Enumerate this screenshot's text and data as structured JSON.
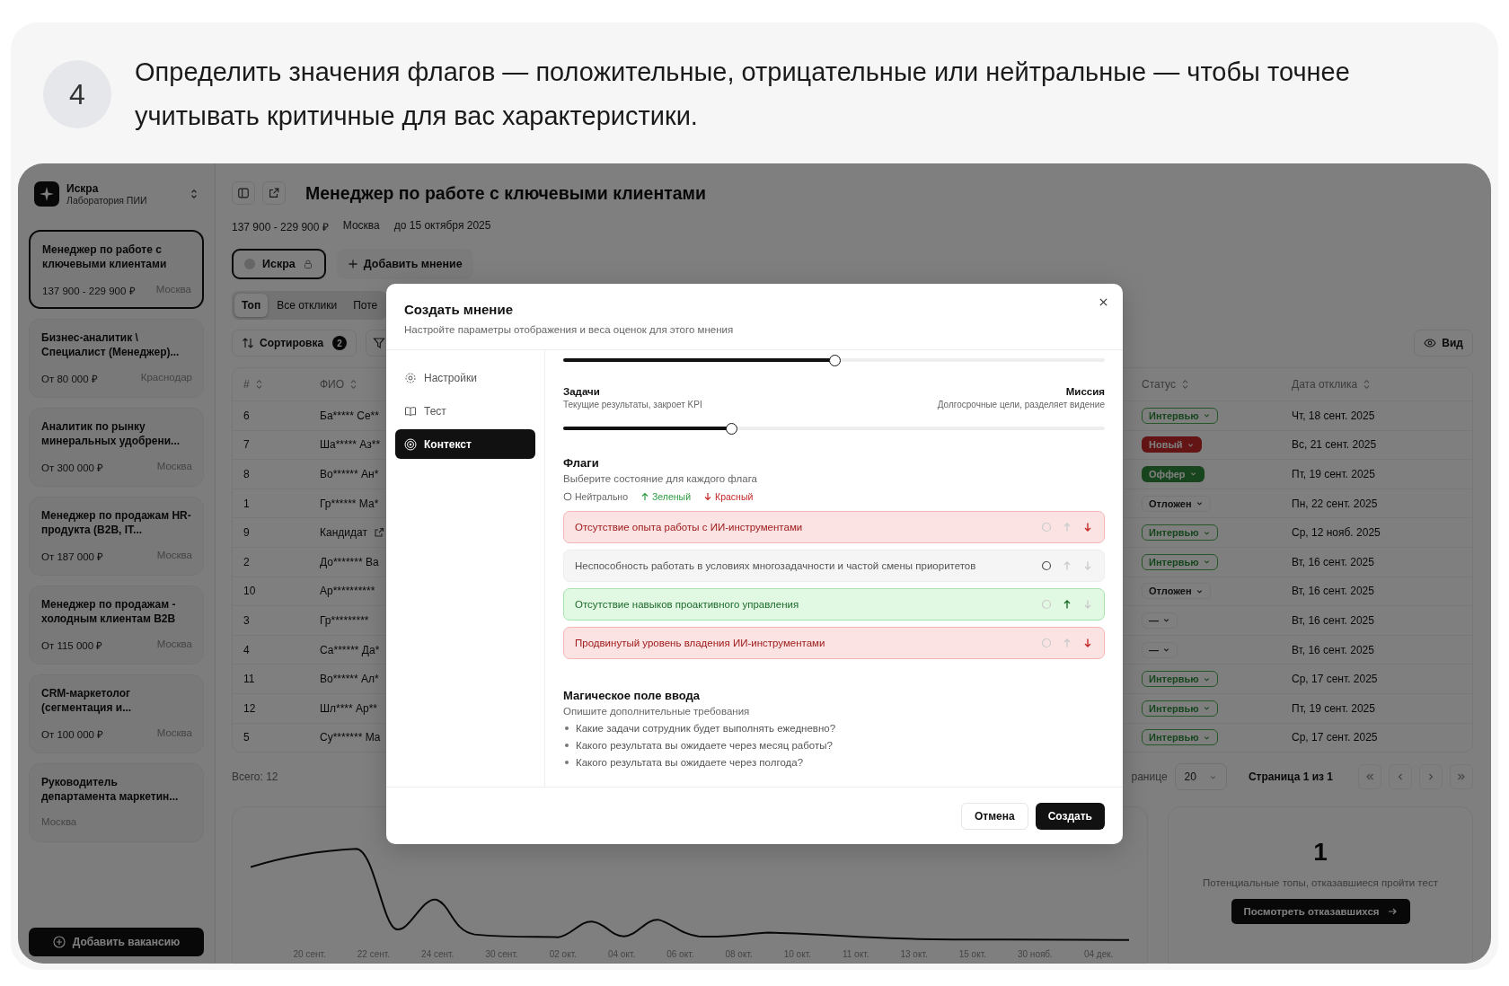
{
  "step": {
    "number": "4",
    "text": "Определить значения флагов — положительные, отрицательные или нейтральные — чтобы точнее учитывать критичные для вас характеристики."
  },
  "org": {
    "name": "Искра",
    "subtitle": "Лаборатория ПИИ"
  },
  "vacancies": [
    {
      "title": "Менеджер по работе с ключевыми клиентами",
      "salary": "137 900 - 229 900 ₽",
      "city": "Москва",
      "selected": true
    },
    {
      "title": "Бизнес-аналитик \\ Специалист (Менеджер)...",
      "salary": "От 80 000 ₽",
      "city": "Краснодар",
      "selected": false
    },
    {
      "title": "Аналитик по рынку минеральных удобрени...",
      "salary": "От 300 000 ₽",
      "city": "Москва",
      "selected": false
    },
    {
      "title": "Менеджер по продажам HR-продукта (B2B, IT...",
      "salary": "От 187 000 ₽",
      "city": "Москва",
      "selected": false
    },
    {
      "title": "Менеджер по продажам - холодным клиентам B2B",
      "salary": "От 115 000 ₽",
      "city": "Москва",
      "selected": false
    },
    {
      "title": "CRM-маркетолог (сегментация и...",
      "salary": "От 100 000 ₽",
      "city": "Москва",
      "selected": false
    },
    {
      "title": "Руководитель департамента маркетин...",
      "city": "Москва",
      "selected": false
    }
  ],
  "add_vacancy": "Добавить вакансию",
  "header": {
    "title": "Менеджер по работе с ключевыми клиентами",
    "salary": "137 900 - 229 900 ₽",
    "city": "Москва",
    "deadline": "до 15 октября 2025"
  },
  "opinions": [
    {
      "label": "Искра",
      "selected": true
    }
  ],
  "add_opinion": "Добавить мнение",
  "tabs": [
    {
      "label": "Топ",
      "selected": true
    },
    {
      "label": "Все отклики",
      "selected": false
    },
    {
      "label": "Поте",
      "selected": false
    }
  ],
  "sort": {
    "label": "Сортировка",
    "count": "2"
  },
  "view": "Вид",
  "table": {
    "columns": [
      "#",
      "ФИО",
      "Статус",
      "Дата отклика"
    ],
    "rows": [
      {
        "num": "6",
        "name": "Ба***** Се**",
        "external": false,
        "status": {
          "label": "Интервью",
          "kind": "interview"
        },
        "date": "Чт, 18 сент. 2025"
      },
      {
        "num": "7",
        "name": "Ша***** Аз**",
        "external": false,
        "status": {
          "label": "Новый",
          "kind": "new"
        },
        "date": "Вс, 21 сент. 2025"
      },
      {
        "num": "8",
        "name": "Во****** Ан*",
        "external": false,
        "status": {
          "label": "Оффер",
          "kind": "offer"
        },
        "date": "Пт, 19 сент. 2025"
      },
      {
        "num": "1",
        "name": "Гр****** Ма*",
        "external": false,
        "status": {
          "label": "Отложен",
          "kind": "postponed"
        },
        "date": "Пн, 22 сент. 2025"
      },
      {
        "num": "9",
        "name": "Кандидат",
        "external": true,
        "status": {
          "label": "Интервью",
          "kind": "interview"
        },
        "date": "Ср, 12 нояб. 2025"
      },
      {
        "num": "2",
        "name": "До******* Ва",
        "external": false,
        "status": {
          "label": "Интервью",
          "kind": "interview"
        },
        "date": "Вт, 16 сент. 2025"
      },
      {
        "num": "10",
        "name": "Ар**********",
        "external": false,
        "status": {
          "label": "Отложен",
          "kind": "postponed"
        },
        "date": "Вт, 16 сент. 2025"
      },
      {
        "num": "3",
        "name": "Гр*********",
        "external": false,
        "status": {
          "label": "—",
          "kind": "empty"
        },
        "date": "Вт, 16 сент. 2025"
      },
      {
        "num": "4",
        "name": "Са****** Да*",
        "external": false,
        "status": {
          "label": "—",
          "kind": "empty"
        },
        "date": "Вт, 16 сент. 2025"
      },
      {
        "num": "11",
        "name": "Во****** Ал*",
        "external": false,
        "status": {
          "label": "Интервью",
          "kind": "interview"
        },
        "date": "Ср, 17 сент. 2025"
      },
      {
        "num": "12",
        "name": "Шл**** Ар**",
        "external": false,
        "status": {
          "label": "Интервью",
          "kind": "interview"
        },
        "date": "Пт, 19 сент. 2025"
      },
      {
        "num": "5",
        "name": "Су******* Ма",
        "external": false,
        "status": {
          "label": "Интервью",
          "kind": "interview"
        },
        "date": "Ср, 17 сент. 2025"
      }
    ]
  },
  "total": "Всего: 12",
  "pagination": {
    "rows_label": "ранице",
    "page_size": "20",
    "page": "Страница 1 из 1"
  },
  "chart": {
    "x_labels": [
      "20 сент.",
      "22 сент.",
      "24 сент.",
      "30 сент.",
      "02 окт.",
      "04 окт.",
      "06 окт.",
      "08 окт.",
      "10 окт.",
      "11 окт.",
      "13 окт.",
      "15 окт.",
      "30 нояб.",
      "04 дек."
    ]
  },
  "summary": {
    "value": "1",
    "caption": "Потенциальные топы, отказавшиеся пройти тест",
    "button": "Посмотреть отказавшихся"
  },
  "modal": {
    "title": "Создать мнение",
    "subtitle": "Настройте параметры отображения и веса оценок для этого мнения",
    "nav": [
      {
        "label": "Настройки",
        "selected": false
      },
      {
        "label": "Тест",
        "selected": false
      },
      {
        "label": "Контекст",
        "selected": true
      }
    ],
    "sliders": [
      {
        "level": 0.5
      },
      {
        "left_title": "Задачи",
        "left_desc": "Текущие результаты, закроет KPI",
        "right_title": "Миссия",
        "right_desc": "Долгосрочные цели, разделяет видение",
        "level": 0.31
      }
    ],
    "flags": {
      "title": "Флаги",
      "desc": "Выберите состояние для каждого флага",
      "legend": [
        {
          "kind": "neutral",
          "label": "Нейтрально"
        },
        {
          "kind": "green",
          "label": "Зеленый"
        },
        {
          "kind": "red",
          "label": "Красный"
        }
      ],
      "items": [
        {
          "label": "Отсутствие опыта работы с ИИ-инструментами",
          "kind": "red"
        },
        {
          "label": "Неспособность работать в условиях многозадачности и частой смены приоритетов",
          "kind": "neutral"
        },
        {
          "label": "Отсутствие навыков проактивного управления",
          "kind": "green"
        },
        {
          "label": "Продвинутый уровень владения ИИ-инструментами",
          "kind": "red"
        }
      ]
    },
    "magic": {
      "title": "Магическое поле ввода",
      "desc": "Опишите дополнительные требования",
      "hints": [
        "Какие задачи сотрудник будет выполнять ежедневно?",
        "Какого результата вы ожидаете через месяц работы?",
        "Какого результата вы ожидаете через полгода?"
      ]
    },
    "cancel": "Отмена",
    "submit": "Создать"
  }
}
